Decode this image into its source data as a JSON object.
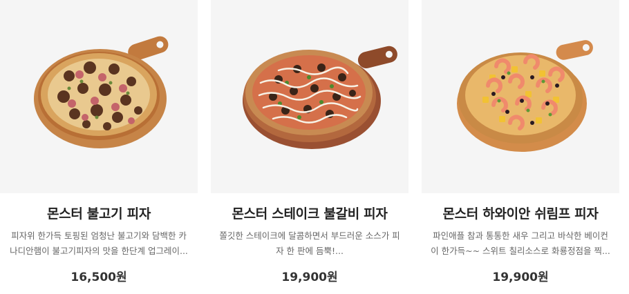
{
  "products": [
    {
      "name": "몬스터 불고기 피자",
      "desc_line1": "피자위 한가득 토핑된 엄청난 불고기와 담백한 카",
      "desc_line2": "나디안햄이 불고기피자의 맛을 한단계 업그레이...",
      "price": "16,500원",
      "image": "bulgogi-pizza-image"
    },
    {
      "name": "몬스터 스테이크 불갈비 피자",
      "desc_line1": "쫄깃한 스테이크에 달콤하면서 부드러운 소스가 피",
      "desc_line2": "자 한 판에 듬뿍!...",
      "price": "19,900원",
      "image": "steak-bulgalbi-pizza-image"
    },
    {
      "name": "몬스터 하와이안 쉬림프 피자",
      "desc_line1": "파인애플 참과 통통한 새우 그리고 바삭한 베이컨",
      "desc_line2": "이 한가득~~ 스위트 칠리소스로 화룡정점을 찍...",
      "price": "19,900원",
      "image": "hawaiian-shrimp-pizza-image"
    }
  ],
  "colors": {
    "thumb_bg": "#f5f5f5",
    "name": "#222222",
    "desc": "#666666",
    "price": "#333333",
    "board": "#c97a3f"
  }
}
